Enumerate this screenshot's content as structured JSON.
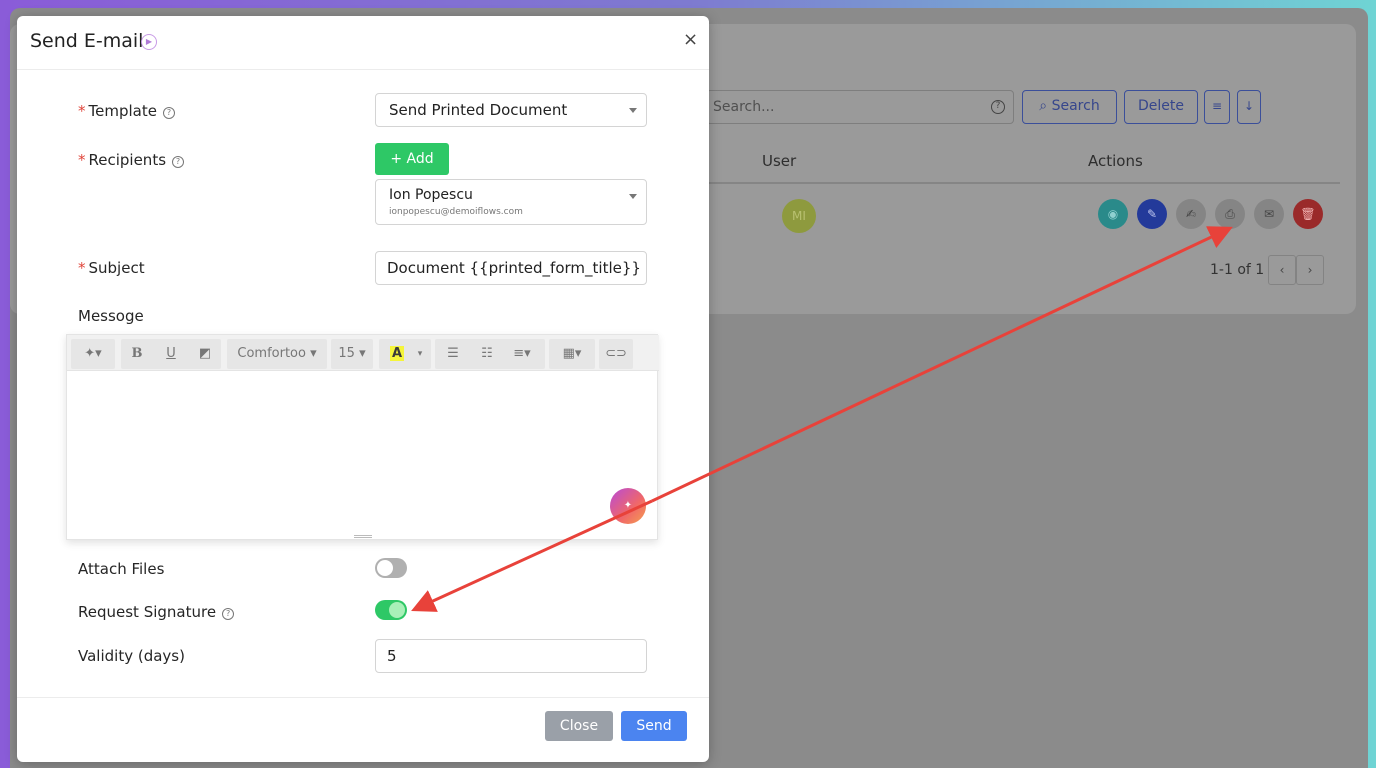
{
  "dialog": {
    "title": "Send E-mail",
    "close_glyph": "×",
    "template": {
      "label": "Template",
      "value": "Send Printed Document"
    },
    "recipients": {
      "label": "Recipients",
      "add_label": "+ Add",
      "selected": {
        "name": "Ion Popescu",
        "email": "ionpopescu@demoiflows.com"
      }
    },
    "subject": {
      "label": "Subject",
      "value": "Document {{printed_form_title}}"
    },
    "message": {
      "label": "Messoge",
      "toolbar": {
        "font": "Comfortoo",
        "size": "15"
      }
    },
    "attach_files": {
      "label": "Attach Files",
      "enabled": false
    },
    "request_signature": {
      "label": "Request Signature",
      "enabled": true
    },
    "validity": {
      "label": "Validity (days)",
      "value": "5"
    },
    "footer": {
      "close_label": "Close",
      "send_label": "Send"
    }
  },
  "background": {
    "search_placeholder": "Search...",
    "search_label": "Search",
    "delete_label": "Delete",
    "columns": {
      "user": "User",
      "actions": "Actions"
    },
    "row": {
      "avatar_initials": "MI"
    },
    "pagination": "1-1 of 1"
  },
  "colors": {
    "add_green": "#2ec866",
    "send_blue": "#4b84f0",
    "arrow_red": "#e8423a",
    "required_red": "#e0453a"
  }
}
